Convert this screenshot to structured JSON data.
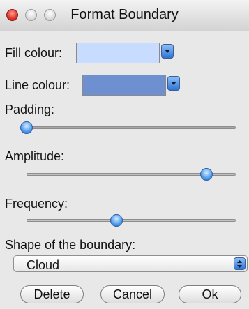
{
  "window": {
    "title": "Format Boundary"
  },
  "fill_colour": {
    "label": "Fill colour:",
    "color": "#c7dcff"
  },
  "line_colour": {
    "label": "Line colour:",
    "color": "#6e8fd0"
  },
  "padding": {
    "label": "Padding:",
    "value": 0.0
  },
  "amplitude": {
    "label": "Amplitude:",
    "value": 0.86
  },
  "frequency": {
    "label": "Frequency:",
    "value": 0.43
  },
  "shape": {
    "label": "Shape of the boundary:",
    "value": "Cloud"
  },
  "buttons": {
    "delete": "Delete",
    "cancel": "Cancel",
    "ok": "Ok"
  },
  "icons": {
    "dropdown": "chevron-down-icon",
    "stepper": "up-down-arrows-icon"
  }
}
